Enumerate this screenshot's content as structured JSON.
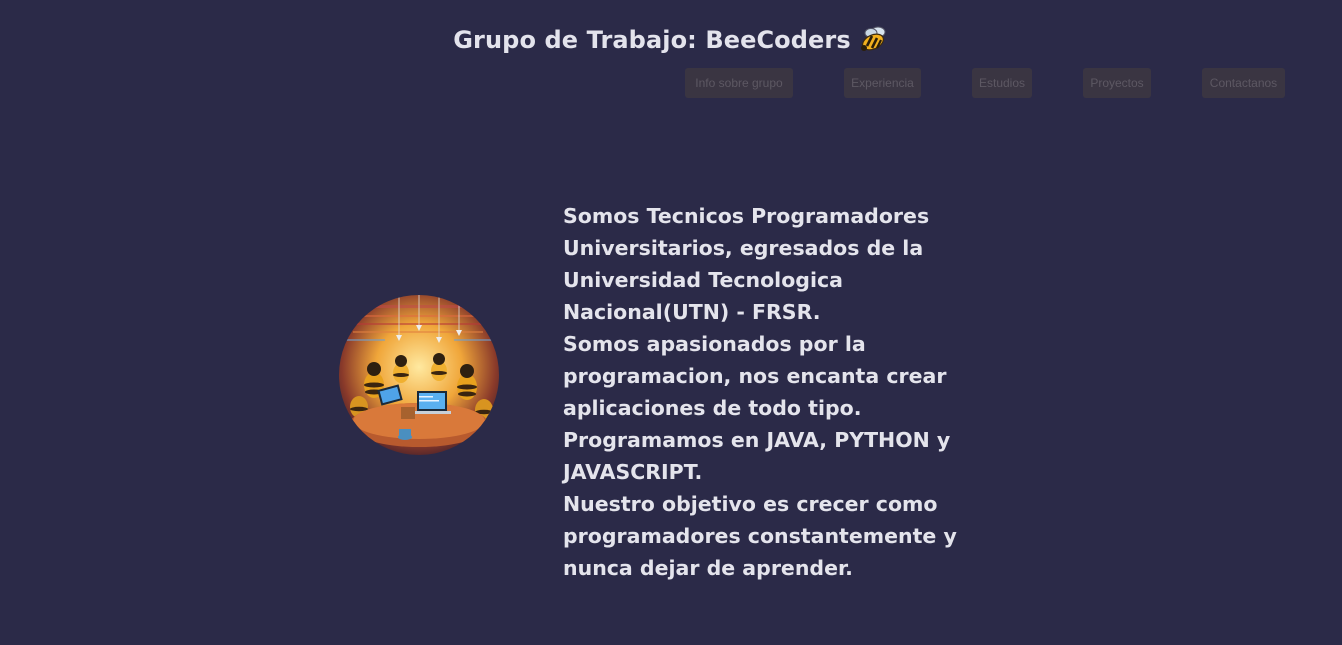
{
  "header": {
    "title": "Grupo de Trabajo: BeeCoders",
    "icon": "bee-icon"
  },
  "nav": {
    "items": [
      {
        "label": "Info sobre grupo"
      },
      {
        "label": "Experiencia"
      },
      {
        "label": "Estudios"
      },
      {
        "label": "Proyectos"
      },
      {
        "label": "Contactanos"
      }
    ]
  },
  "about": {
    "paragraphs": [
      "Somos Tecnicos Programadores Universitarios, egresados de la Universidad Tecnologica Nacional(UTN) - FRSR.",
      "Somos apasionados por la programacion, nos encanta crear aplicaciones de todo tipo.",
      "Programamos en JAVA, PYTHON y JAVASCRIPT.",
      "Nuestro objetivo es crecer como programadores constantemente y nunca dejar de aprender."
    ]
  },
  "colors": {
    "background": "#2b2a48",
    "text": "#e4e4ec",
    "nav_button_bg": "#3a3542",
    "nav_button_text": "#5d5863"
  }
}
